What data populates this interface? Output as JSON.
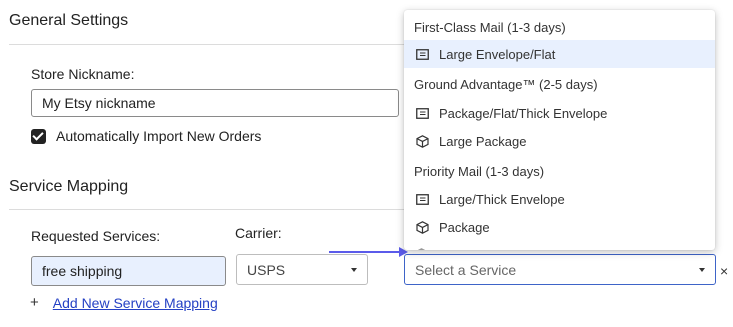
{
  "general": {
    "title": "General Settings",
    "store_nickname_label": "Store Nickname:",
    "store_nickname_value": "My Etsy nickname",
    "auto_import_label": "Automatically Import New Orders",
    "auto_import_checked": true
  },
  "service_mapping": {
    "title": "Service Mapping",
    "requested_services_label": "Requested Services:",
    "carrier_label": "Carrier:",
    "requested_service_value": "free shipping",
    "carrier_value": "USPS",
    "service_placeholder": "Select a Service",
    "remove_label": "×",
    "add_plus": "+",
    "add_label": "Add New Service Mapping"
  },
  "dropdown": {
    "groups": [
      {
        "label": "First-Class Mail (1-3 days)",
        "items": [
          {
            "label": "Large Envelope/Flat",
            "icon": "envelope-icon",
            "selected": true
          }
        ]
      },
      {
        "label": "Ground Advantage™ (2-5 days)",
        "items": [
          {
            "label": "Package/Flat/Thick Envelope",
            "icon": "envelope-icon",
            "selected": false
          },
          {
            "label": "Large Package",
            "icon": "package-icon",
            "selected": false
          }
        ]
      },
      {
        "label": "Priority Mail (1-3 days)",
        "items": [
          {
            "label": "Large/Thick Envelope",
            "icon": "envelope-icon",
            "selected": false
          },
          {
            "label": "Package",
            "icon": "package-icon",
            "selected": false
          }
        ]
      }
    ]
  },
  "colors": {
    "accent": "#3e64c8",
    "highlight_bg": "#e8f0fe",
    "link": "#2440c4",
    "arrow": "#5b5bea"
  }
}
